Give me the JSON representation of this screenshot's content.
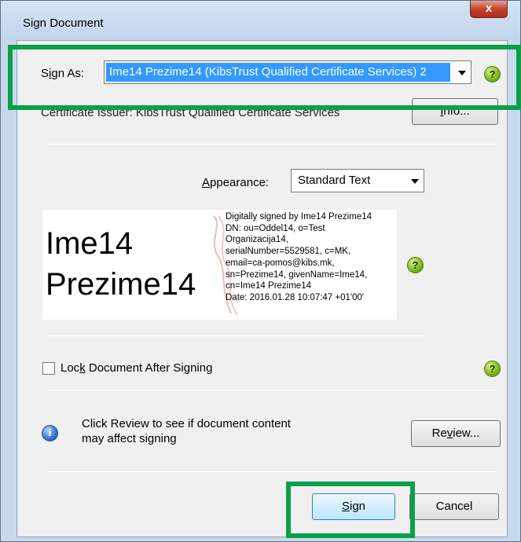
{
  "window": {
    "title": "Sign Document",
    "close_label": "x"
  },
  "sign_as": {
    "label_pre": "S",
    "label_u": "i",
    "label_post": "gn As:",
    "value": "Ime14 Prezime14 (KibsTrust Qualified Certificate Services) 2"
  },
  "issuer": {
    "text": "Certificate Issuer: KibsTrust Qualified Certificate Services"
  },
  "info_button": {
    "label_pre": "",
    "label_u": "I",
    "label_post": "nfo..."
  },
  "appearance": {
    "label_u": "A",
    "label_post": "ppearance:",
    "value": "Standard Text"
  },
  "signature_preview": {
    "name_line1": "Ime14",
    "name_line2": "Prezime14",
    "details": [
      "Digitally signed by Ime14 Prezime14",
      "DN: ou=Oddel14, o=Test",
      "Organizacija14,",
      "serialNumber=5529581, c=MK,",
      "email=ca-pomos@kibs.mk,",
      "sn=Prezime14, givenName=Ime14,",
      "cn=Ime14 Prezime14",
      "Date: 2016.01.28 10:07:47 +01'00'"
    ]
  },
  "lock": {
    "label_pre": "Loc",
    "label_u": "k",
    "label_post": " Document After Signing",
    "checked": false
  },
  "review_info": {
    "line1": "Click Review to see if document content",
    "line2": "may affect signing"
  },
  "review_button": {
    "label_pre": "Re",
    "label_u": "v",
    "label_post": "iew..."
  },
  "sign_button": {
    "label_u": "S",
    "label_post": "ign"
  },
  "cancel_button": {
    "label": "Cancel"
  },
  "colors": {
    "highlight": "#0aa04a",
    "selection": "#3399ff",
    "help_icon": "#7eb51d",
    "info_icon": "#2d6fc4"
  },
  "icons": [
    "close-icon",
    "help-icon",
    "info-icon",
    "dropdown-arrow-icon",
    "checkbox-icon"
  ]
}
